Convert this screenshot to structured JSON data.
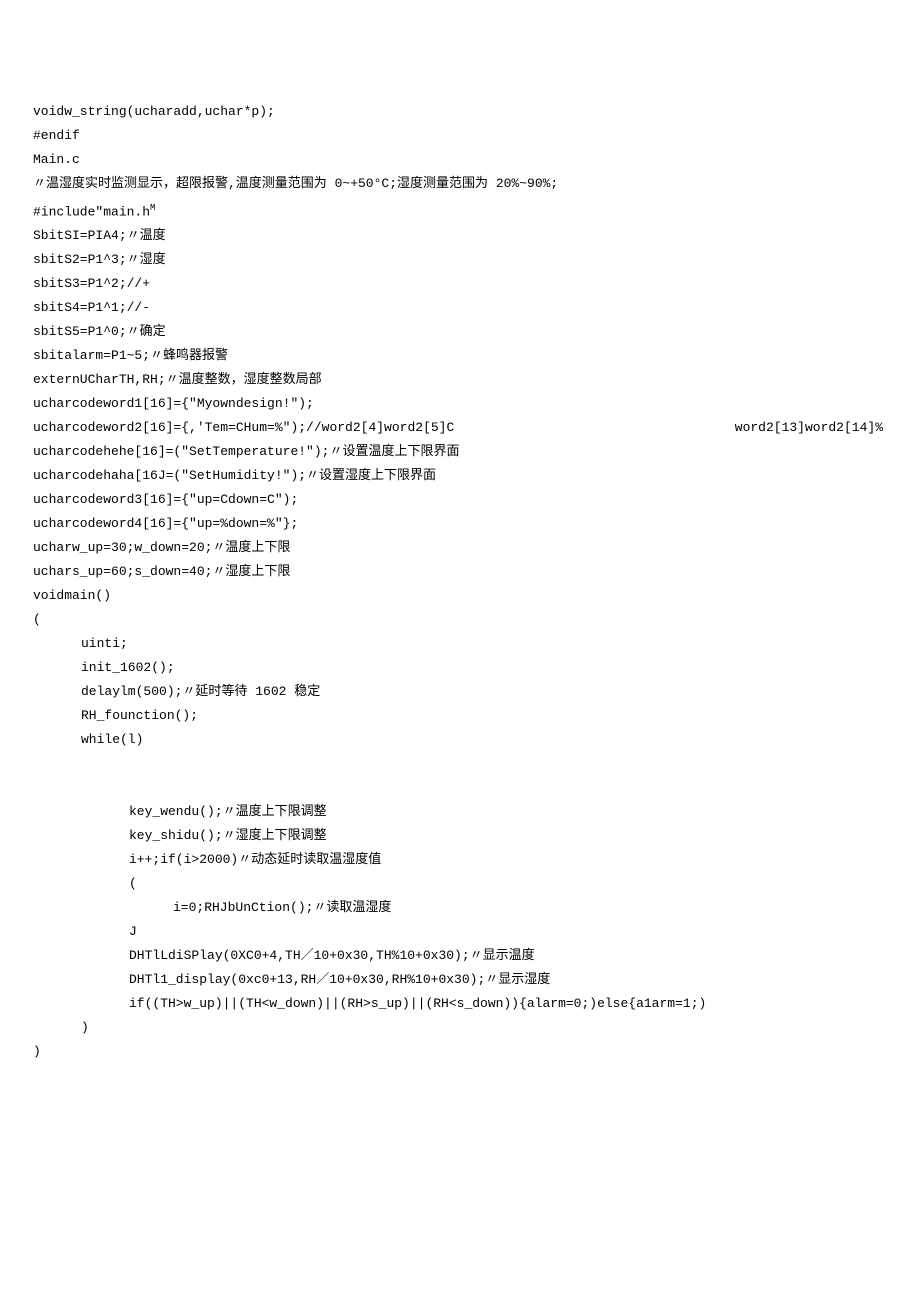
{
  "lines": {
    "l1": "voidw_string(ucharadd,uchar*p);",
    "l2": "#endif",
    "l3": "Main.c",
    "l4": "〃温湿度实时监测显示，超限报警,温度测量范围为 0~+50°C;湿度测量范围为 20%~90%;",
    "l5a": "#include\"main.h",
    "l5b": "M",
    "l6": "SbitSI=PIA4;〃温度",
    "l7": "sbitS2=P1^3;〃湿度",
    "l8": "sbitS3=P1^2;//+",
    "l9": "sbitS4=P1^1;//-",
    "l10": "sbitS5=P1^0;〃确定",
    "l11": "sbitalarm=P1~5;〃蜂鸣器报警",
    "l12": "externUCharTH,RH;〃温度整数，湿度整数局部",
    "l13": "ucharcodeword1[16]={\"Myowndesign!\");",
    "l14a": "ucharcodeword2[16]={,'Tem=CHum=%\");//word2[4]word2[5]C",
    "l14b": "word2[13]word2[14]%",
    "l15": "ucharcodehehe[16]=(\"SetTemperature!\");〃设置温度上下限界面",
    "l16": "ucharcodehaha[16J=(\"SetHumidity!\");〃设置湿度上下限界面",
    "l17": "ucharcodeword3[16]={\"up=Cdown=C\");",
    "l18": "ucharcodeword4[16]={\"up=%down=%\"};",
    "l19": "ucharw_up=30;w_down=20;〃温度上下限",
    "l20": "uchars_up=60;s_down=40;〃湿度上下限",
    "l21": "voidmain()",
    "l22": "(",
    "l23": "uinti;",
    "l24": "init_1602();",
    "l25": "delaylm(500);〃延时等待 1602 稳定",
    "l26": "RH_founction();",
    "l27": "while(l)",
    "l28": "key_wendu();〃温度上下限调整",
    "l29": "key_shidu();〃湿度上下限调整",
    "l30": "i++;if(i>2000)〃动态延时读取温湿度值",
    "l31": "(",
    "l32": "i=0;RHJbUnCtion();〃读取温湿度",
    "l33": "J",
    "l34": "DHTlLdiSPlay(0XC0+4,TH／10+0x30,TH%10+0x30);〃显示温度",
    "l35": "DHTl1_display(0xc0+13,RH／10+0x30,RH%10+0x30);〃显示湿度",
    "l36": "if((TH>w_up)||(TH<w_down)||(RH>s_up)||(RH<s_down)){alarm=0;)else{a1arm=1;)",
    "l37": ")",
    "l38": ")"
  }
}
